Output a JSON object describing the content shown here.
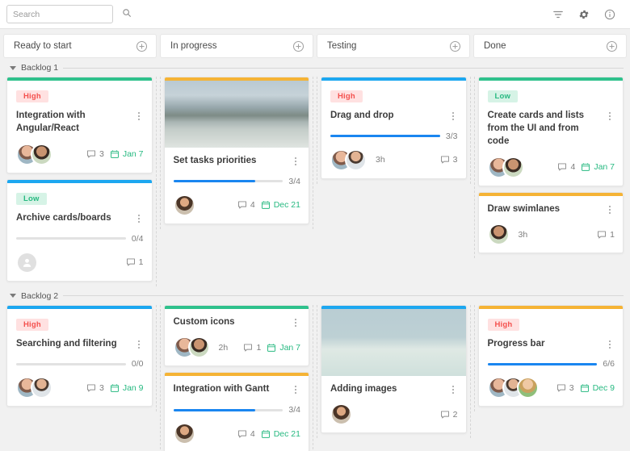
{
  "toolbar": {
    "search": {
      "placeholder": "Search",
      "value": ""
    },
    "icons": [
      {
        "name": "filter-icon",
        "label": "Filter"
      },
      {
        "name": "gear-icon",
        "label": "Settings"
      },
      {
        "name": "info-icon",
        "label": "Info"
      }
    ]
  },
  "columns": [
    {
      "title": "Ready to start",
      "add_label": "+"
    },
    {
      "title": "In progress",
      "add_label": "+"
    },
    {
      "title": "Testing",
      "add_label": "+"
    },
    {
      "title": "Done",
      "add_label": "+"
    }
  ],
  "colors": {
    "accent_green": "#2fc18c",
    "accent_blue": "#1ca7f0",
    "accent_amber": "#f5b335",
    "progress_fill": "#1a86f0",
    "badge_high_bg": "#ffe1e1",
    "badge_high_text": "#f4514e",
    "badge_low_bg": "#d6f3e6",
    "badge_low_text": "#27b981",
    "date_text": "#27b981"
  },
  "swimlanes": [
    {
      "title": "Backlog 1",
      "columns": [
        {
          "cards": [
            {
              "accent": "#2fc18c",
              "badge": {
                "text": "High",
                "type": "high"
              },
              "title": "Integration with Angular/React",
              "avatars": [
                "f-1",
                "m-1"
              ],
              "comments": "3",
              "date": "Jan 7"
            },
            {
              "accent": "#1ca7f0",
              "badge": {
                "text": "Low",
                "type": "low"
              },
              "title": "Archive cards/boards",
              "progress": {
                "label": "0/4",
                "percent": 0
              },
              "avatars": [
                "placeholder"
              ],
              "comments": "1"
            }
          ]
        },
        {
          "cards": [
            {
              "accent": "#f5b335",
              "image": "mountain-lake",
              "title": "Set tasks priorities",
              "progress": {
                "label": "3/4",
                "percent": 75
              },
              "avatars": [
                "f-2"
              ],
              "comments": "4",
              "date": "Dec 21"
            }
          ]
        },
        {
          "cards": [
            {
              "accent": "#1ca7f0",
              "badge": {
                "text": "High",
                "type": "high"
              },
              "title": "Drag and drop",
              "progress": {
                "label": "3/3",
                "percent": 100
              },
              "avatars": [
                "f-1",
                "m-2"
              ],
              "time": "3h",
              "comments": "3"
            }
          ]
        },
        {
          "cards": [
            {
              "accent": "#2fc18c",
              "badge": {
                "text": "Low",
                "type": "low"
              },
              "title": "Create cards and lists from the UI and from code",
              "avatars": [
                "f-1",
                "m-1"
              ],
              "comments": "4",
              "date": "Jan 7"
            },
            {
              "accent": "#f5b335",
              "title": "Draw swimlanes",
              "avatars": [
                "m-1"
              ],
              "time": "3h",
              "comments": "1"
            }
          ]
        }
      ]
    },
    {
      "title": "Backlog 2",
      "columns": [
        {
          "cards": [
            {
              "accent": "#1ca7f0",
              "badge": {
                "text": "High",
                "type": "high"
              },
              "title": "Searching and filtering",
              "progress": {
                "label": "0/0",
                "percent": 0
              },
              "avatars": [
                "f-1",
                "m-2"
              ],
              "comments": "3",
              "date": "Jan 9"
            }
          ]
        },
        {
          "cards": [
            {
              "accent": "#2fc18c",
              "title": "Custom icons",
              "avatars": [
                "f-1",
                "m-1"
              ],
              "time": "2h",
              "comments": "1",
              "date": "Jan 7"
            },
            {
              "accent": "#f5b335",
              "title": "Integration with Gantt",
              "progress": {
                "label": "3/4",
                "percent": 75
              },
              "avatars": [
                "f-2"
              ],
              "comments": "4",
              "date": "Dec 21"
            }
          ]
        },
        {
          "cards": [
            {
              "accent": "#1ca7f0",
              "image": "oranges",
              "title": "Adding images",
              "avatars": [
                "f-2"
              ],
              "comments": "2"
            }
          ]
        },
        {
          "cards": [
            {
              "accent": "#f5b335",
              "badge": {
                "text": "High",
                "type": "high"
              },
              "title": "Progress bar",
              "progress": {
                "label": "6/6",
                "percent": 100
              },
              "avatars": [
                "f-1",
                "m-2",
                "f-3"
              ],
              "comments": "3",
              "date": "Dec 9"
            }
          ]
        }
      ]
    }
  ]
}
